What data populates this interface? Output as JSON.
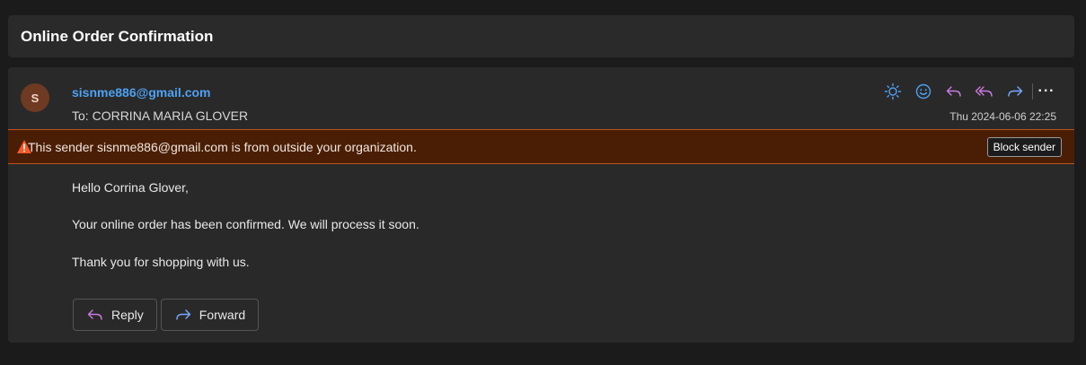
{
  "subject": "Online Order Confirmation",
  "sender": {
    "avatar_initial": "S",
    "email": "sisnme886@gmail.com",
    "to_label": "To:",
    "to_name": "CORRINA MARIA GLOVER",
    "timestamp": "Thu 2024-06-06 22:25"
  },
  "toolbar": {
    "icons": [
      "brightness-icon",
      "emoji-icon",
      "reply-icon",
      "reply-all-icon",
      "forward-icon",
      "more-icon"
    ],
    "more_label": "···"
  },
  "warning": {
    "text": "This sender sisnme886@gmail.com is from outside your organization.",
    "block_label": "Block sender"
  },
  "body": {
    "greeting": "Hello Corrina Glover,",
    "line1": "Your online order has been confirmed. We will process it soon.",
    "line2": "Thank you for shopping with us."
  },
  "actions": {
    "reply_label": "Reply",
    "forward_label": "Forward"
  },
  "colors": {
    "background": "#1b1b1b",
    "card": "#292929",
    "sender_link": "#4ea1f3",
    "brightness_icon": "#4ea1f3",
    "emoji_icon": "#4ea1f3",
    "reply_icons": "#c87ce0",
    "forward_icon": "#7aa8ff",
    "warning_bg": "#4a1e05",
    "warning_border": "#b8541d",
    "warning_icon": "#f25a2a",
    "avatar_bg": "#6e3a22"
  }
}
